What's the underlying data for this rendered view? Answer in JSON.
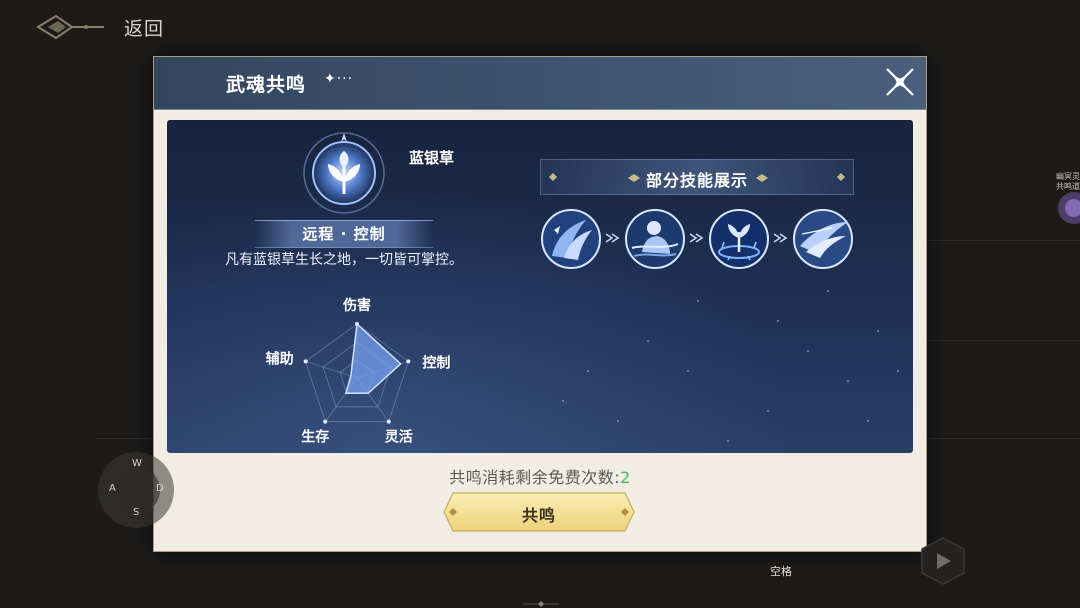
{
  "topbar": {
    "back_label": "返回"
  },
  "dialog": {
    "title": "武魂共鸣",
    "title_decoration": "✦···",
    "close_icon": "close-x-icon"
  },
  "spirit": {
    "name": "蓝银草",
    "tags": "远程 · 控制",
    "description": "凡有蓝银草生长之地，一切皆可掌控。",
    "icon": "blue-silver-grass-emblem-icon",
    "radar": {
      "axes": [
        "伤害",
        "控制",
        "灵活",
        "生存",
        "辅助"
      ],
      "values": [
        1.0,
        0.85,
        0.35,
        0.35,
        0.1
      ]
    }
  },
  "skills": {
    "title": "部分技能展示",
    "items": [
      {
        "icon": "skill-vine-wave-icon"
      },
      {
        "icon": "skill-figure-bind-icon"
      },
      {
        "icon": "skill-sprout-field-icon"
      },
      {
        "icon": "skill-blade-slash-icon"
      }
    ]
  },
  "resonance": {
    "free_count_label": "共鸣消耗剩余免费次数:",
    "free_count_value": "2",
    "button_label": "共鸣"
  },
  "hud": {
    "joystick_keys": {
      "up": "W",
      "left": "A",
      "right": "D",
      "down": "S"
    },
    "space_label": "空格",
    "side_badge_text": "幽冥灵共鸣道"
  },
  "colors": {
    "accent_green": "#3dbf5a",
    "header_blue": "#3f5472",
    "button_gold": "#f2dc8c",
    "panel_navy": "#1f3256"
  }
}
